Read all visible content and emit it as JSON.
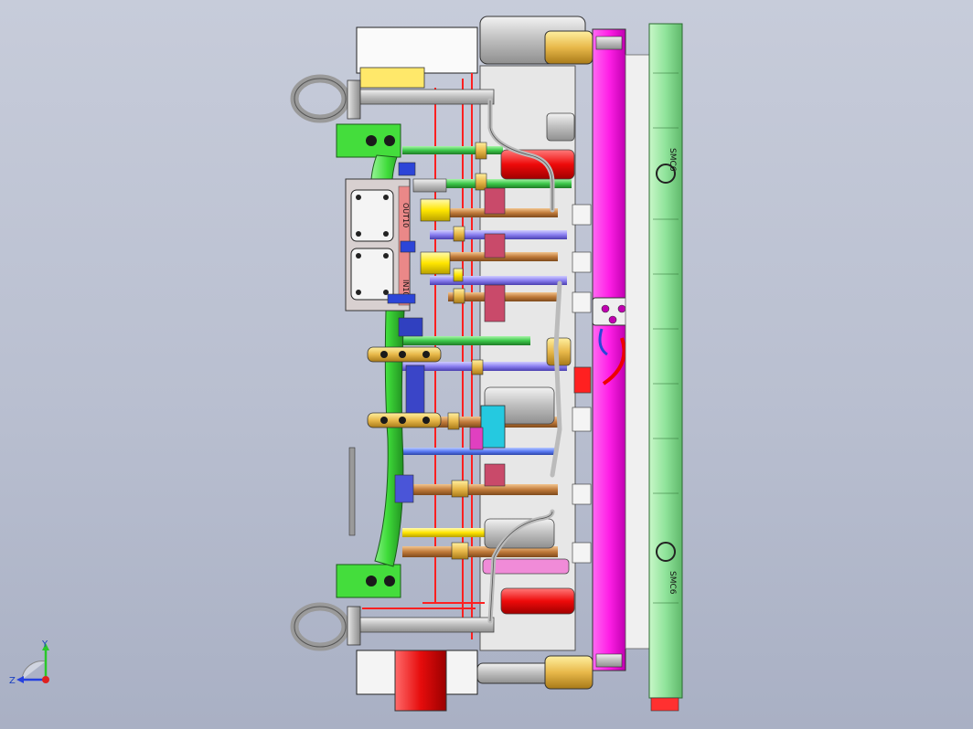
{
  "colors": {
    "background_top": "#c7ccda",
    "background_bottom": "#a9b0c4",
    "magenta_plate": "#ff1fe6",
    "green_plate": "#8fe39a",
    "frame_green": "#3fdc3a",
    "pipe_red": "#ff2020",
    "pipe_yellow": "#ffe600",
    "pipe_copper": "#c98a4a",
    "pipe_violet": "#8a7ff0",
    "pipe_green": "#3cc84a",
    "pipe_blue": "#5b7cf5",
    "cyan": "#25c9e0",
    "steel": "#c8c8c8"
  },
  "plate_labels": {
    "label_top": "SMC6",
    "label_bottom": "SMC6"
  },
  "manifold_labels": {
    "upper": "OUT10",
    "lower": "IN10"
  },
  "triad": {
    "y_axis": "Y",
    "z_axis": "Z"
  }
}
